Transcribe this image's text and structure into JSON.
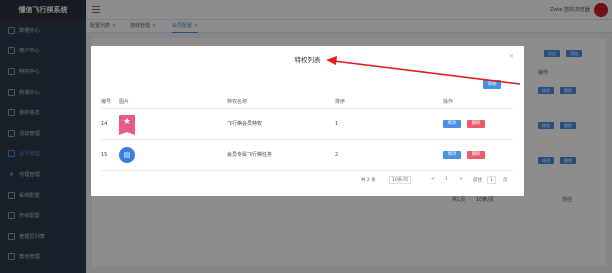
{
  "app": {
    "brand": "懂信飞行棋系统"
  },
  "sidebar": {
    "items": [
      {
        "label": "数据中心",
        "icon": "square-icon"
      },
      {
        "label": "用户中心",
        "icon": "user-icon"
      },
      {
        "label": "特权中心",
        "icon": "square-icon"
      },
      {
        "label": "商城中心",
        "icon": "square-icon"
      },
      {
        "label": "我的信息",
        "icon": "square-icon"
      },
      {
        "label": "活动管理",
        "icon": "square-icon"
      },
      {
        "label": "会员管理",
        "icon": "square-icon"
      },
      {
        "label": "代理管理",
        "icon": "star-icon"
      },
      {
        "label": "系统配置",
        "icon": "square-icon"
      },
      {
        "label": "升级配置",
        "icon": "square-icon"
      },
      {
        "label": "管理员列表",
        "icon": "square-icon"
      },
      {
        "label": "角色管理",
        "icon": "square-icon"
      }
    ],
    "active_index": 6
  },
  "header": {
    "user_text": "Zwie 您的浏览器"
  },
  "tabs": [
    {
      "label": "配置列表"
    },
    {
      "label": "游戏管理"
    },
    {
      "label": "会员配置"
    }
  ],
  "background": {
    "btn_top": "导出",
    "btn_top2": "添加",
    "col_action": "操作",
    "row_edit": "修改",
    "row_del": "删除",
    "pager_text": "共1页",
    "pager_text2": "10条/页",
    "pager_goto": "前往"
  },
  "modal": {
    "title": "特权列表",
    "add_label": "添加",
    "columns": [
      "编号",
      "图片",
      "特权名称",
      "排序",
      "操作"
    ],
    "rows": [
      {
        "id": "14",
        "image": "star-badge",
        "name": "飞行棋会员特权",
        "sort": "1",
        "edit": "修改",
        "delete": "删除"
      },
      {
        "id": "15",
        "image": "doc-badge",
        "name": "会员专属飞行棋任务",
        "sort": "2",
        "edit": "修改",
        "delete": "删除"
      }
    ],
    "pager": {
      "total": "共 2 条",
      "size": "10条/页",
      "prev": "<",
      "page": "1",
      "next": ">",
      "goto": "前往",
      "goto_value": "1",
      "unit": "页"
    }
  },
  "colors": {
    "accent": "#4a90e2",
    "danger": "#e95d6a",
    "sidebar": "#2f3b4c",
    "arrow": "#e02020"
  }
}
